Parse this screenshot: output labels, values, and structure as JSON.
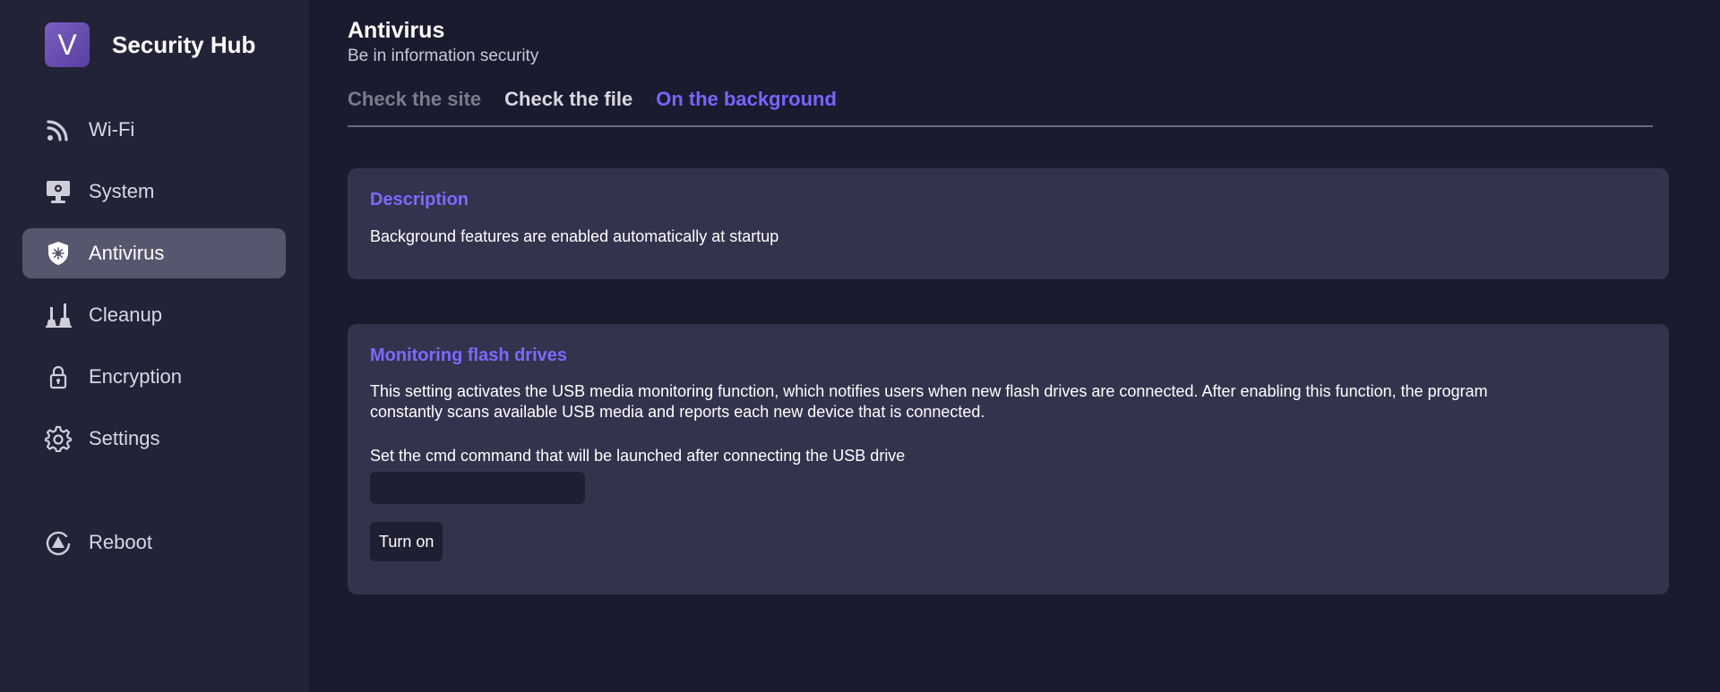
{
  "app": {
    "logo_letter": "V",
    "name": "Security Hub"
  },
  "sidebar": {
    "items": [
      {
        "label": "Wi-Fi",
        "icon": "wifi-icon"
      },
      {
        "label": "System",
        "icon": "monitor-icon"
      },
      {
        "label": "Antivirus",
        "icon": "shield-icon",
        "active": true
      },
      {
        "label": "Cleanup",
        "icon": "broom-icon"
      },
      {
        "label": "Encryption",
        "icon": "lock-icon"
      },
      {
        "label": "Settings",
        "icon": "gear-icon"
      }
    ],
    "reboot_label": "Reboot"
  },
  "header": {
    "title": "Antivirus",
    "subtitle": "Be in information security"
  },
  "tabs": [
    {
      "label": "Check the site",
      "state": "muted"
    },
    {
      "label": "Check the file",
      "state": "normal"
    },
    {
      "label": "On the background",
      "state": "active"
    }
  ],
  "description_card": {
    "title": "Description",
    "text": "Background features are enabled automatically at startup"
  },
  "monitoring_card": {
    "title": "Monitoring flash drives",
    "text_line1": "This setting activates the USB media monitoring function, which notifies users when new flash drives are connected. After enabling this function, the program",
    "text_line2": "constantly scans available USB media and reports each new device that is connected.",
    "cmd_label": "Set the cmd command that will be launched after connecting the USB drive",
    "cmd_value": "",
    "button_label": "Turn on"
  },
  "colors": {
    "accent": "#7765ff",
    "background": "#1b1b2f",
    "sidebar": "#232338",
    "card": "#33334d"
  }
}
